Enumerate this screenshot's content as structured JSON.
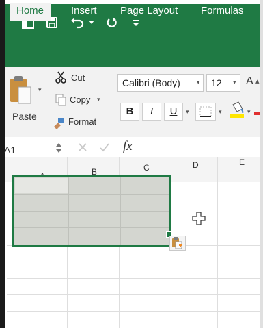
{
  "quick_access": {
    "icons": [
      "sidebar-toggle-icon",
      "save-icon",
      "undo-icon",
      "redo-icon",
      "customize-toolbar-icon"
    ]
  },
  "tabs": [
    {
      "label": "Home",
      "active": true
    },
    {
      "label": "Insert",
      "active": false
    },
    {
      "label": "Page Layout",
      "active": false
    },
    {
      "label": "Formulas",
      "active": false
    }
  ],
  "clipboard": {
    "paste_label": "Paste",
    "cut_label": "Cut",
    "copy_label": "Copy",
    "format_label": "Format"
  },
  "font": {
    "name": "Calibri (Body)",
    "size": "12",
    "grow_label": "A",
    "bold_label": "B",
    "italic_label": "I",
    "underline_label": "U"
  },
  "formula_bar": {
    "name_box": "A1",
    "fx_label": "fx",
    "formula_value": ""
  },
  "columns": [
    "A",
    "B",
    "C",
    "D",
    "E"
  ],
  "colors": {
    "accent": "#1f7a44",
    "selection_fill": "#d4d6d0",
    "fill_color_swatch": "#ffe600",
    "font_color_swatch": "#e03030"
  }
}
